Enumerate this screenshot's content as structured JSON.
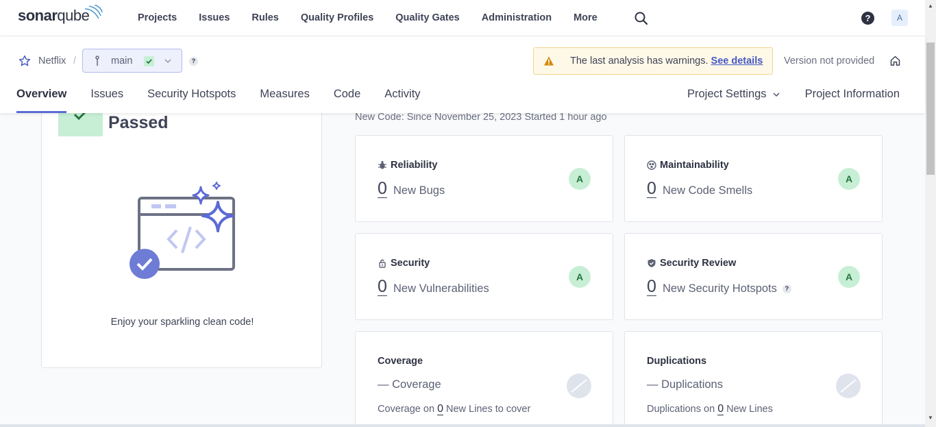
{
  "nav": {
    "logo_text_a": "sonar",
    "logo_text_b": "qube",
    "links": [
      "Projects",
      "Issues",
      "Rules",
      "Quality Profiles",
      "Quality Gates",
      "Administration",
      "More"
    ],
    "help_glyph": "?",
    "avatar_letter": "A"
  },
  "project": {
    "name": "Netflix",
    "separator": "/",
    "branch": "main",
    "help_glyph": "?",
    "warning_text": "The last analysis has warnings.",
    "warning_link": "See details",
    "version": "Version not provided"
  },
  "tabs": [
    "Overview",
    "Issues",
    "Security Hotspots",
    "Measures",
    "Code",
    "Activity"
  ],
  "tabs_right": {
    "settings": "Project Settings",
    "info": "Project Information"
  },
  "quality_gate": {
    "status": "Passed",
    "message": "Enjoy your sparkling clean code!",
    "badge_color": "#c7efd5"
  },
  "new_code": "New Code: Since November 25, 2023  Started 1 hour ago",
  "metrics": [
    {
      "title": "Reliability",
      "icon": "bug-icon",
      "value": "0",
      "label": "New Bugs",
      "grade": "A"
    },
    {
      "title": "Maintainability",
      "icon": "smell-icon",
      "value": "0",
      "label": "New Code Smells",
      "grade": "A"
    },
    {
      "title": "Security",
      "icon": "lock-icon",
      "value": "0",
      "label": "New Vulnerabilities",
      "grade": "A"
    },
    {
      "title": "Security Review",
      "icon": "shield-icon",
      "value": "0",
      "label": "New Security Hotspots",
      "grade": "A",
      "help": "?"
    }
  ],
  "coverage": {
    "title": "Coverage",
    "value": "— Coverage",
    "sub_prefix": "Coverage on",
    "sub_num": "0",
    "sub_suffix": "New Lines to cover"
  },
  "duplications": {
    "title": "Duplications",
    "value": "— Duplications",
    "sub_prefix": "Duplications on",
    "sub_num": "0",
    "sub_suffix": "New Lines"
  },
  "colors": {
    "accent": "#5b6bd6",
    "grade_bg": "#c7efd5",
    "warning_bg": "#fef8e8"
  }
}
